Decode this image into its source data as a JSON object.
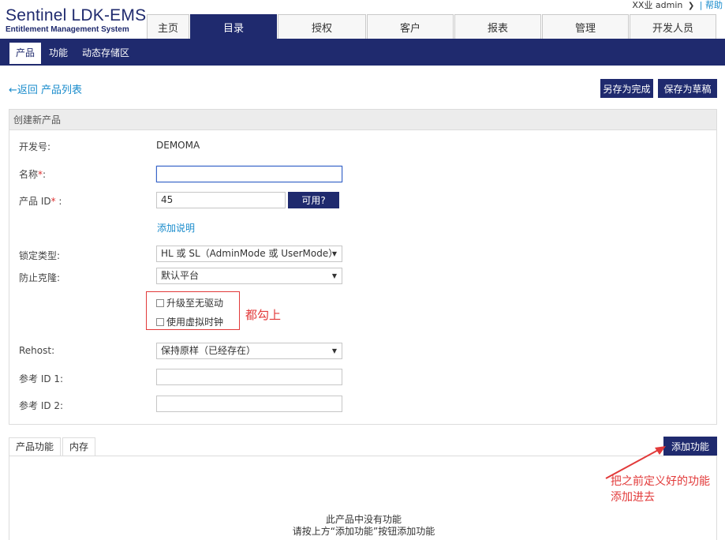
{
  "app": {
    "title": "Sentinel LDK-EMS",
    "subtitle": "Entitlement Management System"
  },
  "user": {
    "name": "XX业 admin",
    "help": "| 帮助"
  },
  "main_tabs": [
    {
      "label": "主页",
      "active": false
    },
    {
      "label": "目录",
      "active": true
    },
    {
      "label": "授权",
      "active": false
    },
    {
      "label": "客户",
      "active": false
    },
    {
      "label": "报表",
      "active": false
    },
    {
      "label": "管理",
      "active": false
    },
    {
      "label": "开发人员",
      "active": false
    }
  ],
  "sub_tabs": [
    {
      "label": "产品",
      "active": true
    },
    {
      "label": "功能",
      "active": false
    },
    {
      "label": "动态存储区",
      "active": false
    }
  ],
  "actions": {
    "back": "←返回 产品列表",
    "save_complete": "另存为完成",
    "save_draft": "保存为草稿"
  },
  "form": {
    "heading": "创建新产品",
    "vendor_label": "开发号:",
    "vendor_value": "DEMOMA",
    "name_label": "名称",
    "name_value": "",
    "product_id_label": "产品 ID",
    "product_id_value": "45",
    "available_button": "可用?",
    "add_description": "添加说明",
    "lock_type_label": "锁定类型:",
    "lock_type_value": "HL 或 SL（AdminMode 或 UserMode）",
    "clone_label": "防止克隆:",
    "clone_value": "默认平台",
    "checkbox_driverless": "升级至无驱动",
    "checkbox_virtual_clock": "使用虚拟时钟",
    "rehost_label": "Rehost:",
    "rehost_value": "保持原样（已经存在）",
    "ref1_label": "参考 ID 1:",
    "ref1_value": "",
    "ref2_label": "参考 ID 2:",
    "ref2_value": ""
  },
  "annotations": {
    "check_all": "都勾上",
    "add_feature_note_1": "把之前定义好的功能",
    "add_feature_note_2": "添加进去"
  },
  "bottom": {
    "tabs": [
      {
        "label": "产品功能",
        "active": true
      },
      {
        "label": "内存",
        "active": false
      }
    ],
    "add_feature_button": "添加功能",
    "empty_line_1": "此产品中没有功能",
    "empty_line_2": "请按上方“添加功能”按钮添加功能"
  },
  "colors": {
    "brand_navy": "#1f2a6e",
    "link_blue": "#1a8ccc",
    "annotation_red": "#e23a3a"
  }
}
